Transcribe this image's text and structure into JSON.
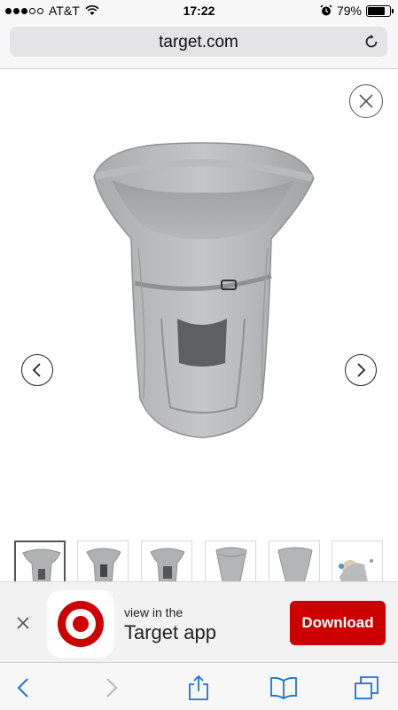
{
  "status_bar": {
    "carrier": "AT&T",
    "signal_bars_filled": 3,
    "signal_bars_total": 5,
    "time": "17:22",
    "battery_percent_label": "79%",
    "battery_level": 0.79,
    "icons": [
      "wifi-icon",
      "alarm-icon",
      "battery-icon"
    ]
  },
  "browser": {
    "url": "target.com",
    "reload_icon": "reload-icon"
  },
  "viewer": {
    "close_icon": "close-icon",
    "prev_icon": "chevron-left-icon",
    "next_icon": "chevron-right-icon",
    "thumbnails_count": 6,
    "selected_thumbnail": 0
  },
  "app_banner": {
    "subtitle": "view in the",
    "title": "Target app",
    "download_label": "Download",
    "close_icon": "close-icon",
    "app_icon": "target-logo-icon",
    "accent_color": "#cc0000"
  },
  "toolbar": {
    "items": [
      "back-icon",
      "forward-icon",
      "share-icon",
      "bookmarks-icon",
      "tabs-icon"
    ],
    "tint_color": "#1a73d9"
  }
}
